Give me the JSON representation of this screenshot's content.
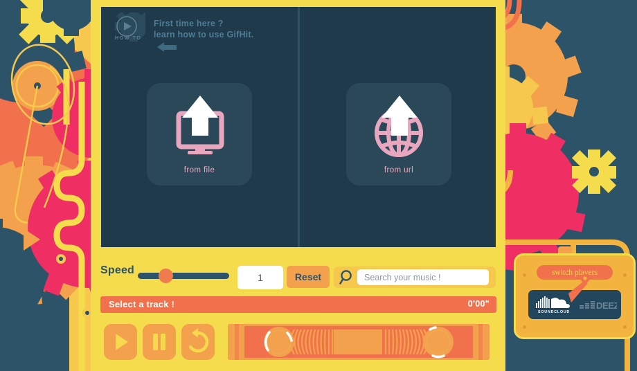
{
  "app": {
    "name": "GifHit",
    "theme": {
      "yellow_frame": "#f4dc4c",
      "panel_dark": "#1f3a4a",
      "background_dark": "#2d5369",
      "accent_orange": "#f3a14c",
      "accent_coral": "#f0714b",
      "accent_pink": "#e9a7bf",
      "accent_magenta": "#ef2f63"
    }
  },
  "howto": {
    "badge_icon": "play-circle-icon",
    "badge_label": "HOW TO",
    "line1": "First time here ?",
    "line2": "learn how to use GifHit.",
    "arrow_icon": "arrow-left-icon"
  },
  "viewer": {
    "tiles": [
      {
        "id": "from-file",
        "label": "from file",
        "icon": "monitor-upload-icon"
      },
      {
        "id": "from-url",
        "label": "from url",
        "icon": "globe-upload-icon"
      }
    ]
  },
  "controls": {
    "speed_label": "Speed",
    "speed_slider": {
      "value": 1,
      "min": 0,
      "max": 3,
      "knob_percent": 30
    },
    "speed_value": "1",
    "reset_label": "Reset",
    "search": {
      "icon": "search-icon",
      "value": "",
      "placeholder": "Search your music !"
    }
  },
  "track": {
    "title": "Select a track !",
    "time": "0'00\"",
    "progress_percent": 0
  },
  "transport": {
    "buttons": [
      {
        "id": "play",
        "icon": "play-icon",
        "label": "Play"
      },
      {
        "id": "pause",
        "icon": "pause-icon",
        "label": "Pause"
      },
      {
        "id": "loop",
        "icon": "loop-icon",
        "label": "Loop"
      }
    ],
    "cassette_icon": "cassette-tape-icon"
  },
  "players": {
    "switch_label": "switch players",
    "pointer_icon": "pin-arrow-icon",
    "options": [
      {
        "id": "soundcloud",
        "label": "SOUNDCLOUD",
        "active": true
      },
      {
        "id": "deezer",
        "label": "DEEZER",
        "active": false
      }
    ]
  }
}
